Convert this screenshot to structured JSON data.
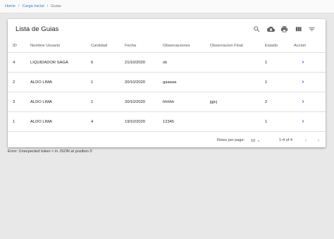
{
  "breadcrumb": {
    "items": [
      "Home",
      "Carga Inicial"
    ],
    "current": "Guias"
  },
  "card": {
    "title": "Lista de Guias",
    "icons": [
      "search-icon",
      "cloud-download-icon",
      "print-icon",
      "view-column-icon",
      "filter-icon"
    ]
  },
  "table": {
    "columns": [
      "ID",
      "Nombre Usuario",
      "Cantidad",
      "Fecha",
      "Observaciones",
      "Observacion Final",
      "Estado",
      "Accion"
    ],
    "rows": [
      {
        "id": "4",
        "usuario": "LIQUIDADOR SAGA",
        "cantidad": "6",
        "fecha": "21/10/2020",
        "observaciones": "ok",
        "obs_final": "",
        "estado": "1"
      },
      {
        "id": "2",
        "usuario": "ALDO LIMA",
        "cantidad": "1",
        "fecha": "20/10/2020",
        "observaciones": "gaaaaa",
        "obs_final": "",
        "estado": "1"
      },
      {
        "id": "3",
        "usuario": "ALDO LIMA",
        "cantidad": "1",
        "fecha": "20/10/2020",
        "observaciones": "hhhhh",
        "obs_final": "jgjcj",
        "estado": "2"
      },
      {
        "id": "1",
        "usuario": "ALDO LIMA",
        "cantidad": "4",
        "fecha": "19/10/2020",
        "observaciones": "12345",
        "obs_final": "",
        "estado": "1"
      }
    ]
  },
  "pagination": {
    "rows_per_page_label": "Rows per page:",
    "rows_per_page": "10",
    "range": "1-4 of 4"
  },
  "error": "Error: Unexpected token < in JSON at position 0",
  "colors": {
    "link": "#3f7cc4",
    "action_chevron": "#2b3fbf",
    "background": "#e8e8e8"
  }
}
